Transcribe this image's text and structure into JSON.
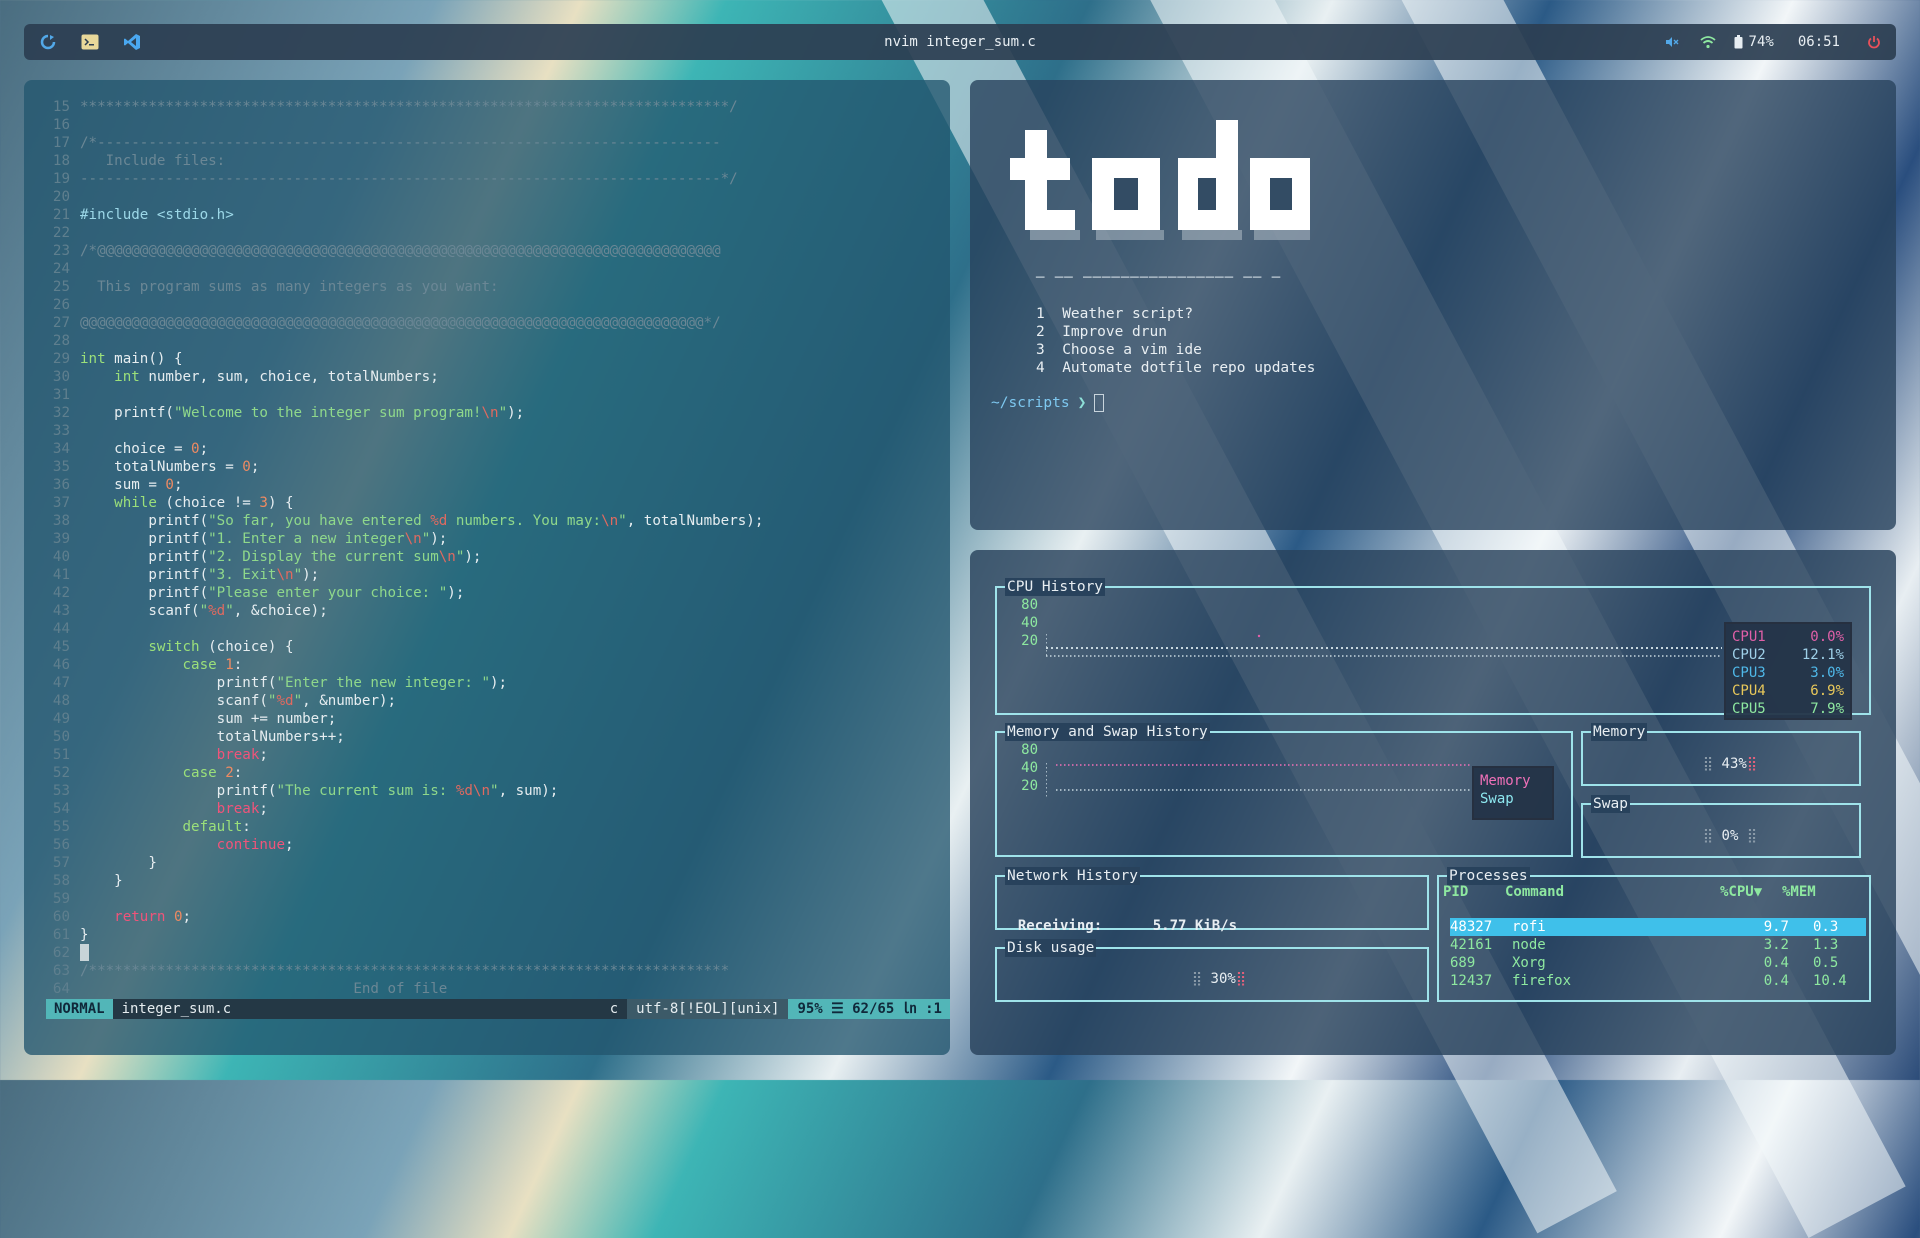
{
  "colors": {
    "accent": "#52b6b8",
    "cpu1": "#e060a8",
    "cpu2": "#9fd0e8",
    "cpu3": "#4fb8e8",
    "cpu4": "#e8c85a",
    "cpu5": "#8ee8a0",
    "memory": "#f070b8",
    "swap": "#8ee8f0",
    "selection": "#3fc0ea"
  },
  "topbar": {
    "title": "nvim integer_sum.c",
    "icons": [
      "refresh-icon",
      "terminal-icon",
      "vscode-icon"
    ],
    "volume_icon": "muted-speaker-icon",
    "wifi_icon": "wifi-icon",
    "battery_icon": "battery-icon",
    "battery": "74%",
    "time": "06:51",
    "power_icon": "power-icon"
  },
  "editor": {
    "lines": [
      {
        "n": "15",
        "parts": [
          [
            "cm",
            "****************************************************************************/"
          ]
        ]
      },
      {
        "n": "16",
        "parts": []
      },
      {
        "n": "17",
        "parts": [
          [
            "cm",
            "/*-------------------------------------------------------------------------"
          ]
        ]
      },
      {
        "n": "18",
        "parts": [
          [
            "cm",
            "   Include files:"
          ]
        ]
      },
      {
        "n": "19",
        "parts": [
          [
            "cm",
            "---------------------------------------------------------------------------*/"
          ]
        ]
      },
      {
        "n": "20",
        "parts": []
      },
      {
        "n": "21",
        "parts": [
          [
            "pp",
            "#include <stdio.h>"
          ]
        ]
      },
      {
        "n": "22",
        "parts": []
      },
      {
        "n": "23",
        "parts": [
          [
            "cm",
            "/*@@@@@@@@@@@@@@@@@@@@@@@@@@@@@@@@@@@@@@@@@@@@@@@@@@@@@@@@@@@@@@@@@@@@@@@@@"
          ]
        ]
      },
      {
        "n": "24",
        "parts": []
      },
      {
        "n": "25",
        "parts": [
          [
            "cm",
            "  This program sums as many integers as you want:"
          ]
        ]
      },
      {
        "n": "26",
        "parts": []
      },
      {
        "n": "27",
        "parts": [
          [
            "cm",
            "@@@@@@@@@@@@@@@@@@@@@@@@@@@@@@@@@@@@@@@@@@@@@@@@@@@@@@@@@@@@@@@@@@@@@@@@@*/"
          ]
        ]
      },
      {
        "n": "28",
        "parts": []
      },
      {
        "n": "29",
        "parts": [
          [
            "ty",
            "int"
          ],
          [
            "tx",
            " main() {"
          ]
        ]
      },
      {
        "n": "30",
        "parts": [
          [
            "tx",
            "    "
          ],
          [
            "ty",
            "int"
          ],
          [
            "tx",
            " number, sum, choice, totalNumbers;"
          ]
        ]
      },
      {
        "n": "31",
        "parts": []
      },
      {
        "n": "32",
        "parts": [
          [
            "tx",
            "    printf("
          ],
          [
            "st",
            "\"Welcome to the integer sum program!"
          ],
          [
            "esc",
            "\\n"
          ],
          [
            "st",
            "\""
          ],
          [
            "tx",
            ");"
          ]
        ]
      },
      {
        "n": "33",
        "parts": []
      },
      {
        "n": "34",
        "parts": [
          [
            "tx",
            "    choice = "
          ],
          [
            "nm",
            "0"
          ],
          [
            "tx",
            ";"
          ]
        ]
      },
      {
        "n": "35",
        "parts": [
          [
            "tx",
            "    totalNumbers = "
          ],
          [
            "nm",
            "0"
          ],
          [
            "tx",
            ";"
          ]
        ]
      },
      {
        "n": "36",
        "parts": [
          [
            "tx",
            "    sum = "
          ],
          [
            "nm",
            "0"
          ],
          [
            "tx",
            ";"
          ]
        ]
      },
      {
        "n": "37",
        "parts": [
          [
            "tx",
            "    "
          ],
          [
            "kw",
            "while"
          ],
          [
            "tx",
            " (choice != "
          ],
          [
            "nm",
            "3"
          ],
          [
            "tx",
            ") {"
          ]
        ]
      },
      {
        "n": "38",
        "parts": [
          [
            "tx",
            "        printf("
          ],
          [
            "st",
            "\"So far, you have entered "
          ],
          [
            "esc",
            "%d"
          ],
          [
            "st",
            " numbers. You may:"
          ],
          [
            "esc",
            "\\n"
          ],
          [
            "st",
            "\""
          ],
          [
            "tx",
            ", totalNumbers);"
          ]
        ]
      },
      {
        "n": "39",
        "parts": [
          [
            "tx",
            "        printf("
          ],
          [
            "st",
            "\"1. Enter a new integer"
          ],
          [
            "esc",
            "\\n"
          ],
          [
            "st",
            "\""
          ],
          [
            "tx",
            ");"
          ]
        ]
      },
      {
        "n": "40",
        "parts": [
          [
            "tx",
            "        printf("
          ],
          [
            "st",
            "\"2. Display the current sum"
          ],
          [
            "esc",
            "\\n"
          ],
          [
            "st",
            "\""
          ],
          [
            "tx",
            ");"
          ]
        ]
      },
      {
        "n": "41",
        "parts": [
          [
            "tx",
            "        printf("
          ],
          [
            "st",
            "\"3. Exit"
          ],
          [
            "esc",
            "\\n"
          ],
          [
            "st",
            "\""
          ],
          [
            "tx",
            ");"
          ]
        ]
      },
      {
        "n": "42",
        "parts": [
          [
            "tx",
            "        printf("
          ],
          [
            "st",
            "\"Please enter your choice: \""
          ],
          [
            "tx",
            ");"
          ]
        ]
      },
      {
        "n": "43",
        "parts": [
          [
            "tx",
            "        scanf("
          ],
          [
            "st",
            "\""
          ],
          [
            "esc",
            "%d"
          ],
          [
            "st",
            "\""
          ],
          [
            "tx",
            ", &choice);"
          ]
        ]
      },
      {
        "n": "44",
        "parts": []
      },
      {
        "n": "45",
        "parts": [
          [
            "tx",
            "        "
          ],
          [
            "kw",
            "switch"
          ],
          [
            "tx",
            " (choice) {"
          ]
        ]
      },
      {
        "n": "46",
        "parts": [
          [
            "tx",
            "            "
          ],
          [
            "kw",
            "case"
          ],
          [
            "tx",
            " "
          ],
          [
            "nm",
            "1"
          ],
          [
            "tx",
            ":"
          ]
        ]
      },
      {
        "n": "47",
        "parts": [
          [
            "tx",
            "                printf("
          ],
          [
            "st",
            "\"Enter the new integer: \""
          ],
          [
            "tx",
            ");"
          ]
        ]
      },
      {
        "n": "48",
        "parts": [
          [
            "tx",
            "                scanf("
          ],
          [
            "st",
            "\""
          ],
          [
            "esc",
            "%d"
          ],
          [
            "st",
            "\""
          ],
          [
            "tx",
            ", &number);"
          ]
        ]
      },
      {
        "n": "49",
        "parts": [
          [
            "tx",
            "                sum += number;"
          ]
        ]
      },
      {
        "n": "50",
        "parts": [
          [
            "tx",
            "                totalNumbers++;"
          ]
        ]
      },
      {
        "n": "51",
        "parts": [
          [
            "tx",
            "                "
          ],
          [
            "ctl",
            "break"
          ],
          [
            "tx",
            ";"
          ]
        ]
      },
      {
        "n": "52",
        "parts": [
          [
            "tx",
            "            "
          ],
          [
            "kw",
            "case"
          ],
          [
            "tx",
            " "
          ],
          [
            "nm",
            "2"
          ],
          [
            "tx",
            ":"
          ]
        ]
      },
      {
        "n": "53",
        "parts": [
          [
            "tx",
            "                printf("
          ],
          [
            "st",
            "\"The current sum is: "
          ],
          [
            "esc",
            "%d\\n"
          ],
          [
            "st",
            "\""
          ],
          [
            "tx",
            ", sum);"
          ]
        ]
      },
      {
        "n": "54",
        "parts": [
          [
            "tx",
            "                "
          ],
          [
            "ctl",
            "break"
          ],
          [
            "tx",
            ";"
          ]
        ]
      },
      {
        "n": "55",
        "parts": [
          [
            "tx",
            "            "
          ],
          [
            "kw",
            "default"
          ],
          [
            "tx",
            ":"
          ]
        ]
      },
      {
        "n": "56",
        "parts": [
          [
            "tx",
            "                "
          ],
          [
            "ctl",
            "continue"
          ],
          [
            "tx",
            ";"
          ]
        ]
      },
      {
        "n": "57",
        "parts": [
          [
            "tx",
            "        }"
          ]
        ]
      },
      {
        "n": "58",
        "parts": [
          [
            "tx",
            "    }"
          ]
        ]
      },
      {
        "n": "59",
        "parts": []
      },
      {
        "n": "60",
        "parts": [
          [
            "tx",
            "    "
          ],
          [
            "ctl",
            "return"
          ],
          [
            "tx",
            " "
          ],
          [
            "nm",
            "0"
          ],
          [
            "tx",
            ";"
          ]
        ]
      },
      {
        "n": "61",
        "parts": [
          [
            "tx",
            "}"
          ]
        ]
      },
      {
        "n": "62",
        "parts": [
          [
            "cursor",
            ""
          ]
        ]
      },
      {
        "n": "63",
        "parts": [
          [
            "cm",
            "/***************************************************************************"
          ]
        ]
      },
      {
        "n": "64",
        "parts": [
          [
            "cm",
            "                                End of file"
          ]
        ]
      }
    ],
    "statusline": {
      "mode": "NORMAL",
      "file": "integer_sum.c",
      "filetype": "c",
      "encoding": "utf-8[!EOL][unix]",
      "position": "95% ☰ 62/65 ㏑ :1"
    }
  },
  "todo": {
    "logo_text": "todo",
    "underline": "─ ── ──────────────── ── ─",
    "items": [
      "1  Weather script?",
      "2  Improve drun",
      "3  Choose a vim ide",
      "4  Automate dotfile repo updates"
    ],
    "prompt_dir": "~/scripts",
    "prompt_symbol": "❯"
  },
  "btop": {
    "cpu": {
      "title": "CPU History",
      "ticks": [
        "80",
        "40",
        "20"
      ],
      "cores": [
        {
          "name": "CPU1",
          "value": "0.0%",
          "color": "#e060a8"
        },
        {
          "name": "CPU2",
          "value": "12.1%",
          "color": "#9fd0e8"
        },
        {
          "name": "CPU3",
          "value": "3.0%",
          "color": "#4fb8e8"
        },
        {
          "name": "CPU4",
          "value": "6.9%",
          "color": "#e8c85a"
        },
        {
          "name": "CPU5",
          "value": "7.9%",
          "color": "#8ee8a0"
        }
      ]
    },
    "mem_history": {
      "title": "Memory and Swap History",
      "ticks": [
        "80",
        "40",
        "20"
      ],
      "legend": [
        "Memory",
        "Swap"
      ]
    },
    "memory": {
      "title": "Memory",
      "value": "43%",
      "level": 0.43
    },
    "swap": {
      "title": "Swap",
      "value": "0%",
      "level": 0.0
    },
    "network": {
      "title": "Network History",
      "label": "Receiving:",
      "value": "5.77 KiB/s"
    },
    "disk": {
      "title": "Disk usage",
      "value": "30%",
      "level": 0.3
    },
    "processes": {
      "title": "Processes",
      "columns": [
        "PID",
        "Command",
        "%CPU▼",
        "%MEM"
      ],
      "rows": [
        {
          "pid": "48327",
          "cmd": "rofi",
          "cpu": "9.7",
          "mem": "0.3",
          "selected": true
        },
        {
          "pid": "42161",
          "cmd": "node",
          "cpu": "3.2",
          "mem": "1.3",
          "selected": false
        },
        {
          "pid": "689",
          "cmd": "Xorg",
          "cpu": "0.4",
          "mem": "0.5",
          "selected": false
        },
        {
          "pid": "12437",
          "cmd": "firefox",
          "cpu": "0.4",
          "mem": "10.4",
          "selected": false
        }
      ]
    }
  }
}
